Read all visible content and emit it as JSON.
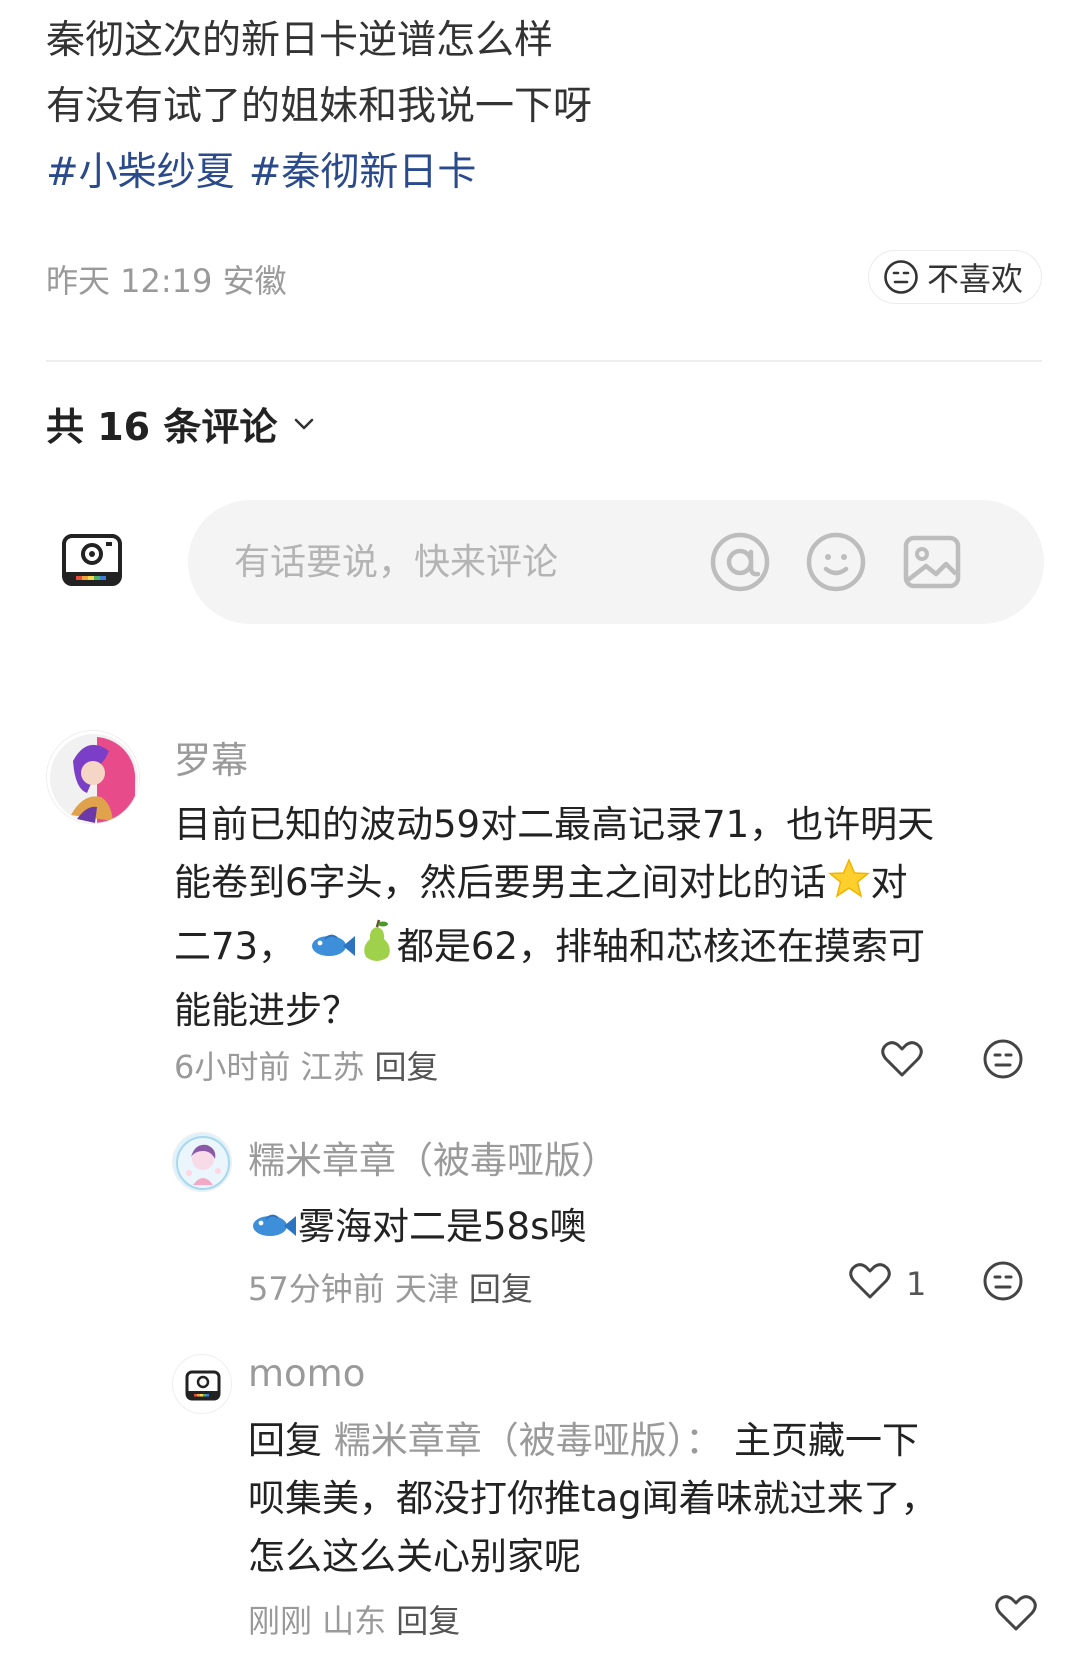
{
  "post": {
    "lines": [
      "秦彻这次的新日卡逆谱怎么样",
      "有没有试了的姐妹和我说一下呀"
    ],
    "tags": [
      "#小柴纱夏",
      "#秦彻新日卡"
    ],
    "meta": "昨天 12:19 安徽",
    "dislike_label": "不喜欢"
  },
  "comments_header": "共 16 条评论",
  "composer": {
    "placeholder": "有话要说，快来评论"
  },
  "comments": [
    {
      "name": "罗幕",
      "body": [
        "目前已知的波动59对二最高记录71，也许明天",
        "能卷到6字头，然后要男主之间对比的话",
        "对",
        "二73，",
        "都是62，排轴和芯核还在摸索可",
        "能能进步？"
      ],
      "meta": "6小时前 江苏",
      "reply_label": "回复"
    },
    {
      "name": "糯米章章（被毒哑版）",
      "body": "雾海对二是58s噢",
      "meta": "57分钟前 天津",
      "reply_label": "回复",
      "likes": "1"
    },
    {
      "name": "momo",
      "reply_prefix": "回复",
      "reply_target": "糯米章章（被毒哑版）：",
      "body_first": "主页藏一下",
      "body_rest": [
        "呗集美，都没打你推tag闻着味就过来了，",
        "怎么这么关心别家呢"
      ],
      "meta": "刚刚 山东",
      "reply_label": "回复"
    }
  ],
  "colors": {
    "tag": "#2a4a8c",
    "muted": "#9a9a9a",
    "pill_bg": "#f4f4f4"
  },
  "icons": [
    "dislike-face-icon",
    "chevron-down-icon",
    "camera-avatar-icon",
    "at-icon",
    "emoji-icon",
    "image-icon",
    "heart-icon",
    "fish-emoji",
    "pear-emoji",
    "star-emoji"
  ]
}
